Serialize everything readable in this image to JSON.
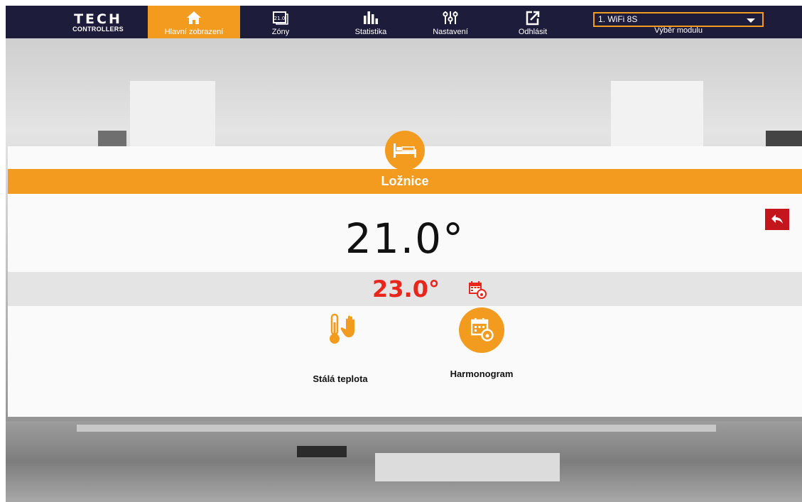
{
  "brand": {
    "name": "TECH",
    "sub": "CONTROLLERS"
  },
  "nav": [
    {
      "label": "Hlavní zobrazení",
      "icon": "home-icon",
      "active": true
    },
    {
      "label": "Zóny",
      "icon": "zones-icon",
      "icon_text": "21.0"
    },
    {
      "label": "Statistika",
      "icon": "statistics-icon"
    },
    {
      "label": "Nastavení",
      "icon": "settings-sliders-icon"
    },
    {
      "label": "Odhlásit",
      "icon": "logout-icon"
    }
  ],
  "module": {
    "selected": "1. WiFi 8S",
    "label": "Výběr modulu"
  },
  "zone": {
    "name": "Ložnice",
    "icon": "bed-icon",
    "current_temp": "21.0°",
    "set_temp": "23.0°",
    "set_icon": "schedule-calendar-icon"
  },
  "modes": {
    "constant": {
      "label": "Stálá teplota",
      "icon": "thermometer-hand-icon"
    },
    "schedule": {
      "label": "Harmonogram",
      "icon": "schedule-calendar-icon"
    }
  },
  "colors": {
    "accent": "#f29b1f",
    "nav_bg": "#1d1d3b",
    "back_button": "#c4151c",
    "set_temp": "#e8261c"
  }
}
